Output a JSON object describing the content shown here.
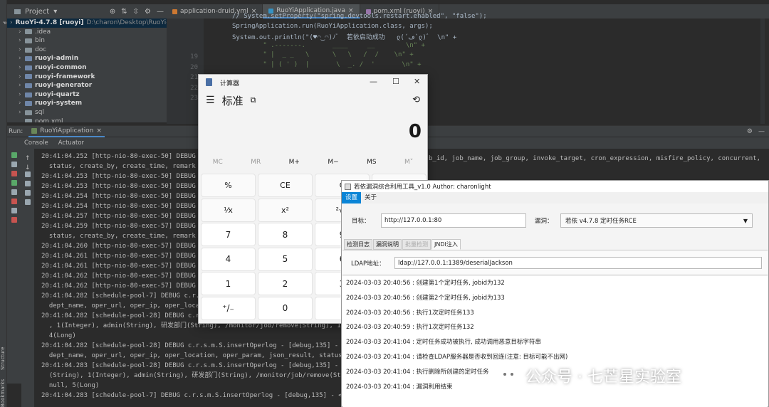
{
  "ide": {
    "project_label": "Project",
    "tree": [
      {
        "label": "RuoYi-4.7.8 [ruoyi]",
        "path": "D:\\charon\\Desktop\\RuoYi-4.7.8",
        "kind": "root"
      },
      {
        "label": ".idea",
        "kind": "folder"
      },
      {
        "label": "bin",
        "kind": "folder"
      },
      {
        "label": "doc",
        "kind": "folder"
      },
      {
        "label": "ruoyi-admin",
        "kind": "module"
      },
      {
        "label": "ruoyi-common",
        "kind": "module"
      },
      {
        "label": "ruoyi-framework",
        "kind": "module"
      },
      {
        "label": "ruoyi-generator",
        "kind": "module"
      },
      {
        "label": "ruoyi-quartz",
        "kind": "module"
      },
      {
        "label": "ruoyi-system",
        "kind": "module"
      },
      {
        "label": "sql",
        "kind": "folder"
      },
      {
        "label": "pom.xml",
        "kind": "file"
      }
    ],
    "tabs": [
      {
        "label": "application-druid.yml",
        "active": false
      },
      {
        "label": "RuoYiApplication.java",
        "active": true
      },
      {
        "label": "pom.xml (ruoyi)",
        "active": false
      }
    ],
    "gutter": [
      "19",
      "20",
      "21",
      "22",
      "23"
    ],
    "code_lines": [
      "// System.setProperty(\"spring.devtools.restart.enabled\", \"false\");",
      "SpringApplication.run(RuoYiApplication.class, args);",
      "System.out.println(\"(♥◠‿◠)ﾉﾞ  若依启动成功   ლ(´ڡ`ლ)ﾞ  \\n\" +",
      "        \" .-------.       ____     __        \\n\" +",
      "        \" |  _ _   \\      \\   \\   /  /    \\n\" +",
      "        \" | ( ' )  |       \\  _. /  '       \\n\" +"
    ],
    "run_label": "Run:",
    "run_config": "RuoYiApplication",
    "run_tabs": [
      "Console",
      "Actuator"
    ],
    "console_lines": [
      "20:41:04.252 [http-nio-80-exec-50] DEBUG c.r",
      "  status, create_by, create_time, remark from",
      "20:41:04.253 [http-nio-80-exec-50] DEBUG c.r",
      "20:41:04.253 [http-nio-80-exec-50] DEBUG c.r",
      "20:41:04.254 [http-nio-80-exec-50] DEBUG c.r",
      "20:41:04.254 [http-nio-80-exec-50] DEBUG c.r",
      "20:41:04.257 [http-nio-80-exec-50] DEBUG c.r",
      "20:41:04.259 [http-nio-80-exec-57] DEBUG c.r",
      "  status, create_by, create_time, remark from",
      "20:41:04.260 [http-nio-80-exec-57] DEBUG c.r",
      "20:41:04.261 [http-nio-80-exec-57] DEBUG c.r",
      "20:41:04.261 [http-nio-80-exec-57] DEBUG c.r",
      "20:41:04.262 [http-nio-80-exec-57] DEBUG c.r",
      "20:41:04.262 [http-nio-80-exec-57] DEBUG c.r",
      "20:41:04.282 [schedule-pool-7] DEBUG c.r.s.m",
      "  dept_name, oper_url, oper_ip, oper_location",
      "20:41:04.282 [schedule-pool-28] DEBUG c.r.s.m.S.insertOperlog - [debug,135] - ==> ",
      "  , 1(Integer), admin(String), 研发部门(String), /monitor/job/remove(String), 172.20.",
      "  4(Long)",
      "20:41:04.282 [schedule-pool-28] DEBUG c.r.s.m.S.insertOperlog - [debug,135] - ==> ",
      "  dept_name, oper_url, oper_ip, oper_location, oper_param, json_result, status, erro",
      "20:41:04.283 [schedule-pool-28] DEBUG c.r.s.m.S.insertOperlog - [debug,135] - ==> P",
      "  (String), 1(Integer), admin(String), 研发部门(String), /monitor/job/remove(String), ",
      "  null, 5(Long)",
      "20:41:04.283 [schedule-pool-7] DEBUG c.r.s.m.S.insertOperlog - [debug,135] - <=="
    ],
    "console_right": "b_id, job_name, job_group, invoke_target, cron_expression, misfire_policy, concurrent,",
    "side_labels": [
      "Structure",
      "Bookmarks"
    ]
  },
  "calc": {
    "title": "计算器",
    "mode": "标准",
    "display": "0",
    "memory": [
      "MC",
      "MR",
      "M+",
      "M−",
      "MS",
      "M˅"
    ],
    "keys": [
      [
        "%",
        "CE",
        "C",
        "⌫"
      ],
      [
        "¹⁄x",
        "x²",
        "²√x",
        "÷"
      ],
      [
        "7",
        "8",
        "9",
        "×"
      ],
      [
        "4",
        "5",
        "6",
        "−"
      ],
      [
        "1",
        "2",
        "3",
        "+"
      ],
      [
        "⁺/₋",
        "0",
        ".",
        "="
      ]
    ]
  },
  "tool": {
    "title": "若依漏洞综合利用工具_v1.0 Author: charonlight",
    "menus": [
      "设置",
      "关于"
    ],
    "target_label": "目标：",
    "target_value": "http://127.0.0.1:80",
    "vuln_label": "漏洞：",
    "vuln_value": "若依 v4.7.8 定时任务RCE",
    "subtabs": [
      "检测日志",
      "漏洞说明",
      "批量检测",
      "JNDI注入"
    ],
    "ldap_label": "LDAP地址：",
    "ldap_value": "ldap://127.0.0.1:1389/deserialJackson",
    "logs": [
      "2024-03-03 20:40:56 : 创建第1个定时任务, jobid为132",
      "2024-03-03 20:40:56 : 创建第2个定时任务, jobid为133",
      "2024-03-03 20:40:56 : 执行1次定时任务133",
      "2024-03-03 20:40:59 : 执行1次定时任务132",
      "2024-03-03 20:41:04 : 定时任务成功被执行, 成功调用恶意目标字符串",
      "2024-03-03 20:41:04 : 请检查LDAP服务器是否收到回连(注意: 目标可能不出网)",
      "2024-03-03 20:41:04 : 执行删除所创建的定时任务",
      "2024-03-03 20:41:04 : 漏洞利用结束"
    ]
  },
  "watermark": {
    "text": "公众号 · 七芒星实验室"
  }
}
